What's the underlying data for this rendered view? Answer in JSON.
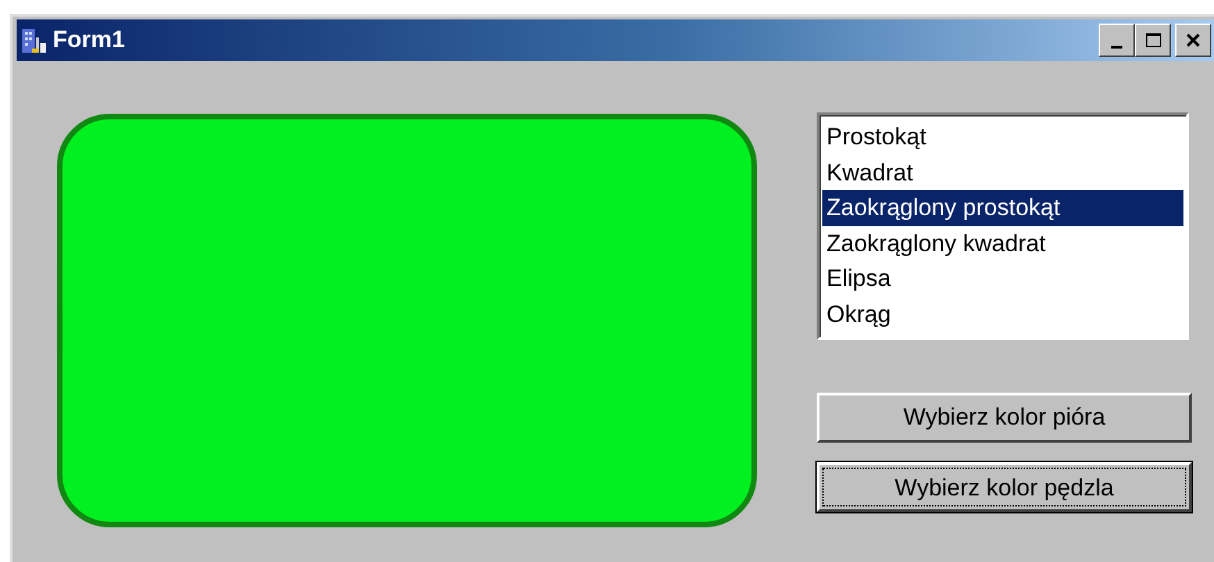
{
  "window": {
    "title": "Form1"
  },
  "listbox": {
    "items": [
      {
        "label": "Prostokąt",
        "selected": false
      },
      {
        "label": "Kwadrat",
        "selected": false
      },
      {
        "label": "Zaokrąglony prostokąt",
        "selected": true
      },
      {
        "label": "Zaokrąglony kwadrat",
        "selected": false
      },
      {
        "label": "Elipsa",
        "selected": false
      },
      {
        "label": "Okrąg",
        "selected": false
      }
    ]
  },
  "buttons": [
    {
      "label": "Wybierz kolor pióra",
      "focused": false
    },
    {
      "label": "Wybierz kolor pędzla",
      "focused": true
    }
  ]
}
